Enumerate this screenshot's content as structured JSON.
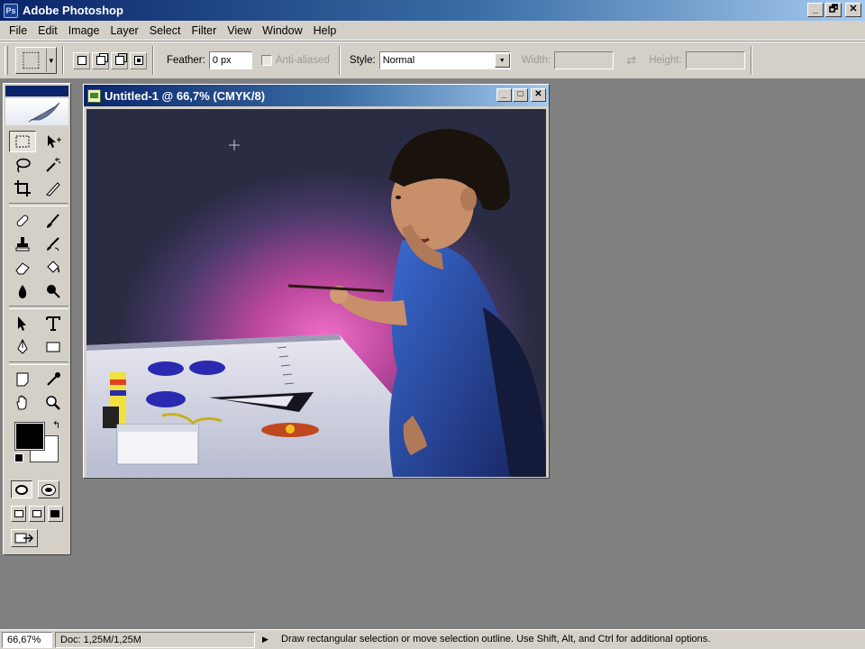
{
  "app": {
    "title": "Adobe Photoshop",
    "window_buttons": [
      "_",
      "🗗",
      "✕"
    ]
  },
  "menu": [
    "File",
    "Edit",
    "Image",
    "Layer",
    "Select",
    "Filter",
    "View",
    "Window",
    "Help"
  ],
  "options": {
    "feather_label": "Feather:",
    "feather_value": "0 px",
    "antialiased_label": "Anti-aliased",
    "style_label": "Style:",
    "style_value": "Normal",
    "width_label": "Width:",
    "height_label": "Height:",
    "width_value": "",
    "height_value": ""
  },
  "toolbox": {
    "tools": [
      "rectangular-marquee-icon",
      "move-icon",
      "lasso-icon",
      "magic-wand-icon",
      "crop-icon",
      "slice-icon",
      "healing-brush-icon",
      "brush-icon",
      "clone-stamp-icon",
      "history-brush-icon",
      "eraser-icon",
      "paint-bucket-icon",
      "blur-icon",
      "dodge-icon",
      "path-selection-icon",
      "type-icon",
      "pen-icon",
      "rectangle-shape-icon",
      "notes-icon",
      "eyedropper-icon",
      "hand-icon",
      "zoom-icon"
    ],
    "foreground_color": "#000000",
    "background_color": "#ffffff"
  },
  "document": {
    "title": "Untitled-1 @ 66,7% (CMYK/8)",
    "buttons": [
      "_",
      "□",
      "✕"
    ]
  },
  "status": {
    "zoom": "66,67%",
    "doc_info": "Doc: 1,25M/1,25M",
    "message": "Draw rectangular selection or move selection outline.  Use Shift, Alt, and Ctrl for additional options."
  },
  "colors": {
    "title_gradient_start": "#0a246a",
    "title_gradient_end": "#a6caf0",
    "workspace": "#808080",
    "chrome": "#d4d0c8"
  }
}
